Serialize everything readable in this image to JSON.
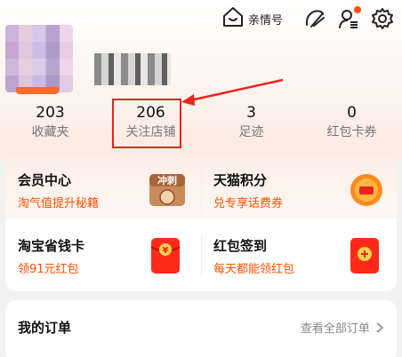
{
  "topbar": {
    "family_label": "亲情号",
    "icons": [
      "family-home-icon",
      "brush-icon",
      "profile-settings-icon",
      "settings-gear-icon"
    ]
  },
  "stats": [
    {
      "num": "203",
      "label": "收藏夹"
    },
    {
      "num": "206",
      "label": "关注店铺"
    },
    {
      "num": "3",
      "label": "足迹"
    },
    {
      "num": "0",
      "label": "红包卡券"
    }
  ],
  "benefits": [
    {
      "title": "会员中心",
      "subtitle": "淘气值提升秘籍",
      "badge": "冲刺"
    },
    {
      "title": "天猫积分",
      "subtitle": "兑专享话费券"
    },
    {
      "title": "淘宝省钱卡",
      "subtitle": "领91元红包",
      "badge": "¥"
    },
    {
      "title": "红包签到",
      "subtitle": "每天都能领红包"
    }
  ],
  "orders": {
    "title": "我的订单",
    "link": "查看全部订单"
  },
  "colors": {
    "accent": "#ff5000",
    "highlight": "#e8241c"
  }
}
